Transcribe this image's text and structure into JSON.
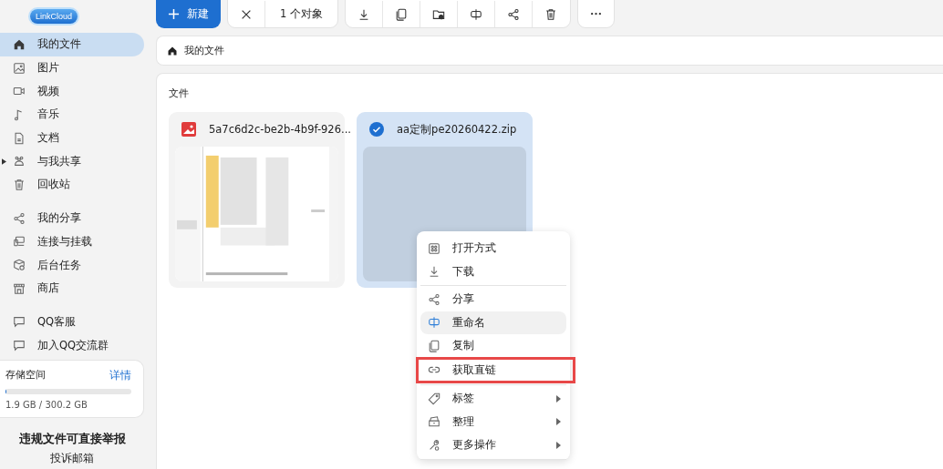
{
  "logo": {
    "text": "LinkCloud"
  },
  "sidebar": {
    "groups": [
      [
        {
          "label": "我的文件",
          "selected": true,
          "collapsible": false
        },
        {
          "label": "图片",
          "selected": false,
          "collapsible": false
        },
        {
          "label": "视频",
          "selected": false,
          "collapsible": false
        },
        {
          "label": "音乐",
          "selected": false,
          "collapsible": false
        },
        {
          "label": "文档",
          "selected": false,
          "collapsible": false
        },
        {
          "label": "与我共享",
          "selected": false,
          "collapsible": true
        },
        {
          "label": "回收站",
          "selected": false,
          "collapsible": false
        }
      ],
      [
        {
          "label": "我的分享",
          "selected": false,
          "collapsible": false
        },
        {
          "label": "连接与挂载",
          "selected": false,
          "collapsible": false
        },
        {
          "label": "后台任务",
          "selected": false,
          "collapsible": false
        },
        {
          "label": "商店",
          "selected": false,
          "collapsible": false
        }
      ],
      [
        {
          "label": "QQ客服",
          "selected": false,
          "collapsible": false
        },
        {
          "label": "加入QQ交流群",
          "selected": false,
          "collapsible": false
        }
      ]
    ]
  },
  "storage": {
    "title": "存储空间",
    "link": "详情",
    "level": 0.006,
    "usage": "1.9 GB / 300.2 GB"
  },
  "report": {
    "title": "违规文件可直接举报",
    "subtitle": "投诉邮箱"
  },
  "toolbar": {
    "new_button": "新建",
    "selection_count": "1 个对象"
  },
  "breadcrumb": {
    "label": "我的文件"
  },
  "files": {
    "heading": "文件",
    "items": [
      {
        "name": "5a7c6d2c-be2b-4b9f-926...",
        "selected": false,
        "kind": "picture"
      },
      {
        "name": "aa定制pe20260422.zip",
        "selected": true
      }
    ]
  },
  "context_menu": {
    "groups": [
      [
        {
          "label": "打开方式",
          "highlighted": false,
          "annotated": false,
          "submenu": false
        },
        {
          "label": "下载",
          "highlighted": false,
          "annotated": false,
          "submenu": false
        }
      ],
      [
        {
          "label": "分享",
          "highlighted": false,
          "annotated": false,
          "submenu": false
        },
        {
          "label": "重命名",
          "highlighted": true,
          "annotated": false,
          "submenu": false
        },
        {
          "label": "复制",
          "highlighted": false,
          "annotated": false,
          "submenu": false
        },
        {
          "label": "获取直链",
          "highlighted": false,
          "annotated": true,
          "submenu": false
        }
      ],
      [
        {
          "label": "标签",
          "highlighted": false,
          "annotated": false,
          "submenu": true
        },
        {
          "label": "整理",
          "highlighted": false,
          "annotated": false,
          "submenu": true
        },
        {
          "label": "更多操作",
          "highlighted": false,
          "annotated": false,
          "submenu": true
        }
      ]
    ]
  }
}
